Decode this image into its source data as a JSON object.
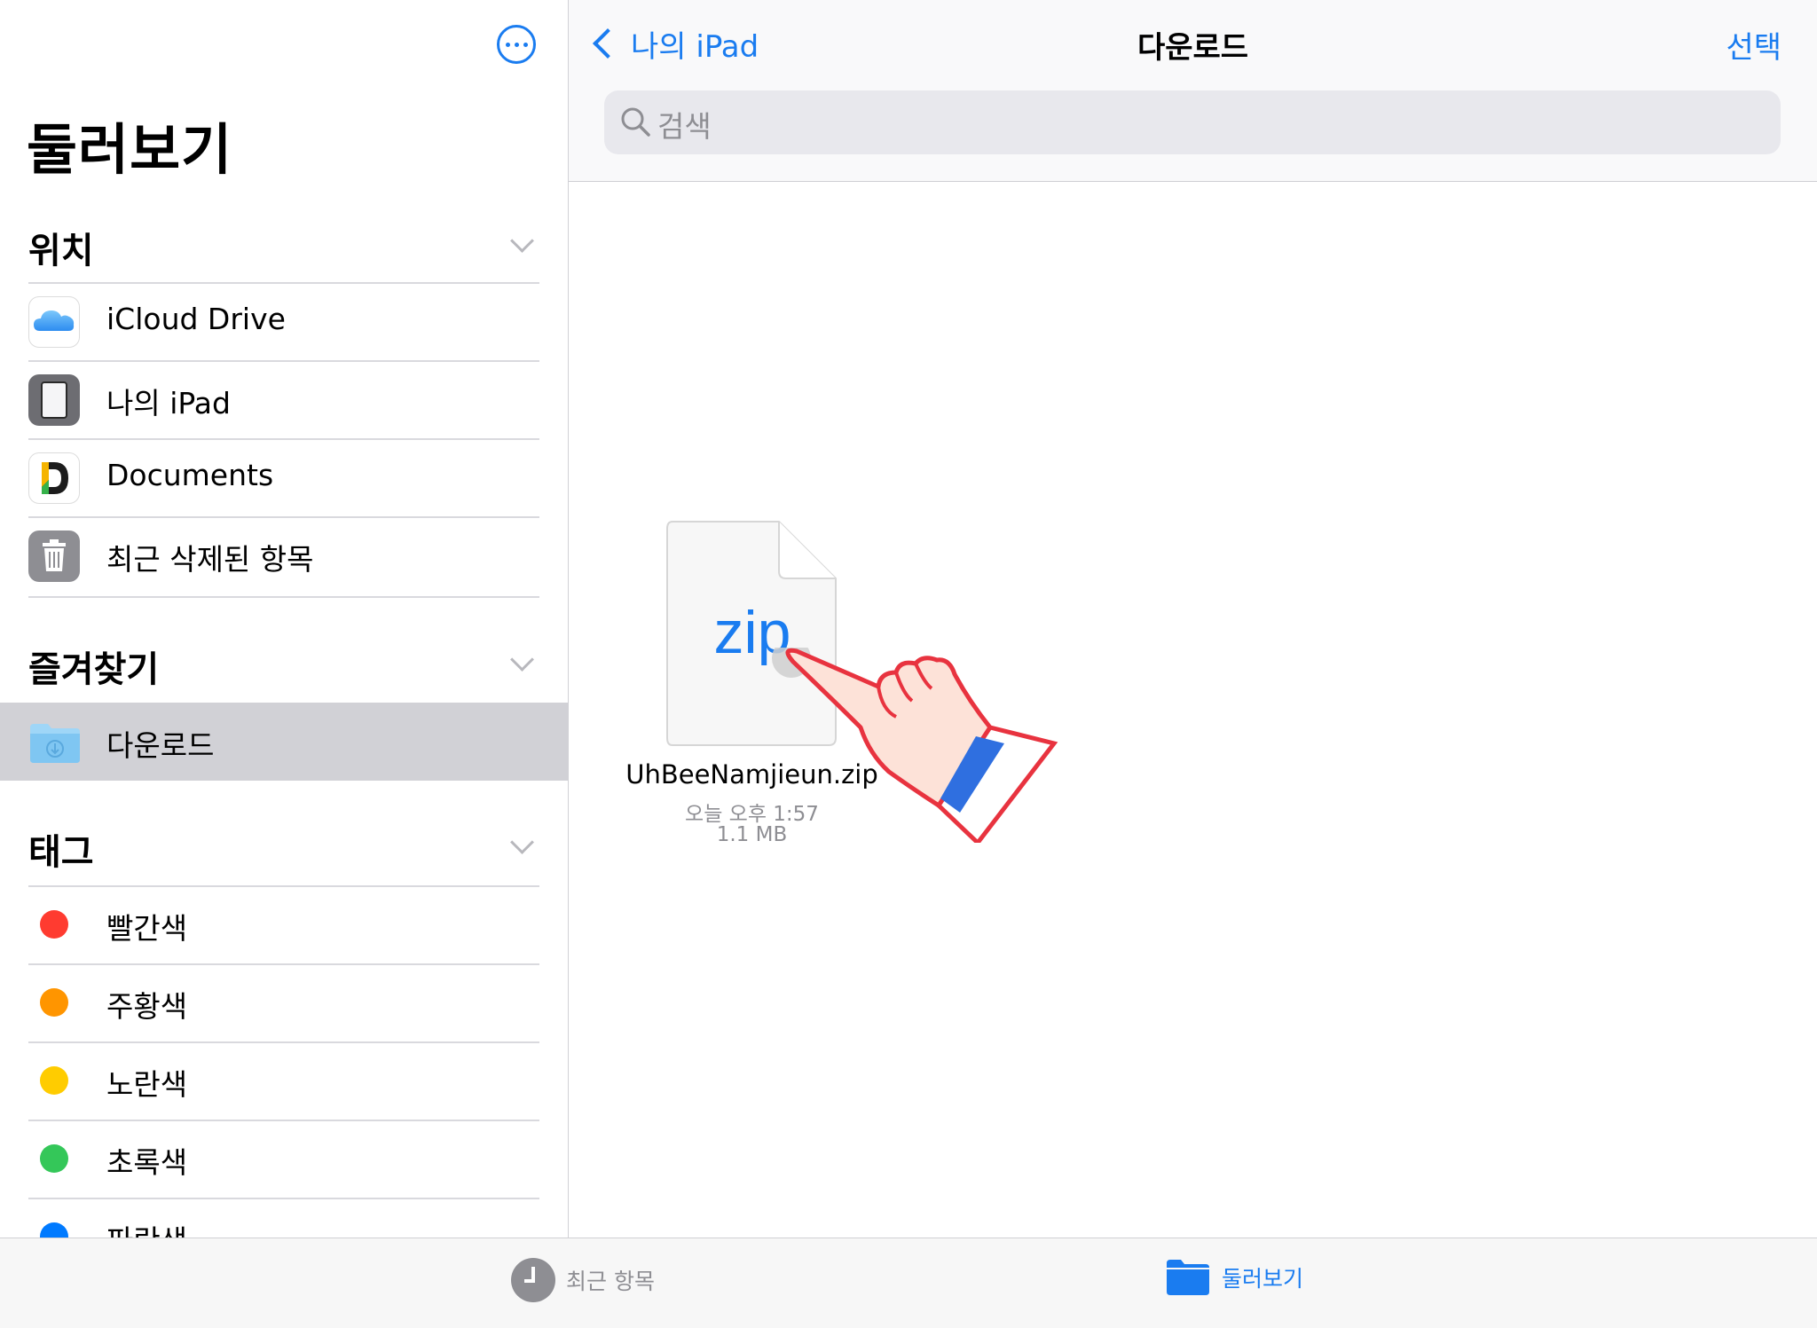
{
  "sidebar": {
    "title": "둘러보기",
    "sections": {
      "locations": {
        "label": "위치",
        "items": [
          {
            "label": "iCloud Drive",
            "icon": "icloud-icon"
          },
          {
            "label": "나의 iPad",
            "icon": "ipad-icon"
          },
          {
            "label": "Documents",
            "icon": "documents-app-icon"
          },
          {
            "label": "최근 삭제된 항목",
            "icon": "trash-icon"
          }
        ]
      },
      "favorites": {
        "label": "즐겨찾기",
        "items": [
          {
            "label": "다운로드",
            "icon": "downloads-folder-icon",
            "selected": true
          }
        ]
      },
      "tags": {
        "label": "태그",
        "items": [
          {
            "label": "빨간색",
            "color": "#ff3b30"
          },
          {
            "label": "주황색",
            "color": "#ff9500"
          },
          {
            "label": "노란색",
            "color": "#ffcc00"
          },
          {
            "label": "초록색",
            "color": "#34c759"
          },
          {
            "label": "파란색",
            "color": "#007aff"
          }
        ]
      }
    }
  },
  "navbar": {
    "back_label": "나의 iPad",
    "title": "다운로드",
    "select_label": "선택",
    "search_placeholder": "검색"
  },
  "file": {
    "badge": "zip",
    "name": "UhBeeNamjieun.zip",
    "date": "오늘 오후 1:57",
    "size": "1.1 MB"
  },
  "tabbar": {
    "recent_label": "최근 항목",
    "browse_label": "둘러보기"
  },
  "colors": {
    "accent": "#1a7cf0",
    "selected_row": "#d1d1d6"
  }
}
